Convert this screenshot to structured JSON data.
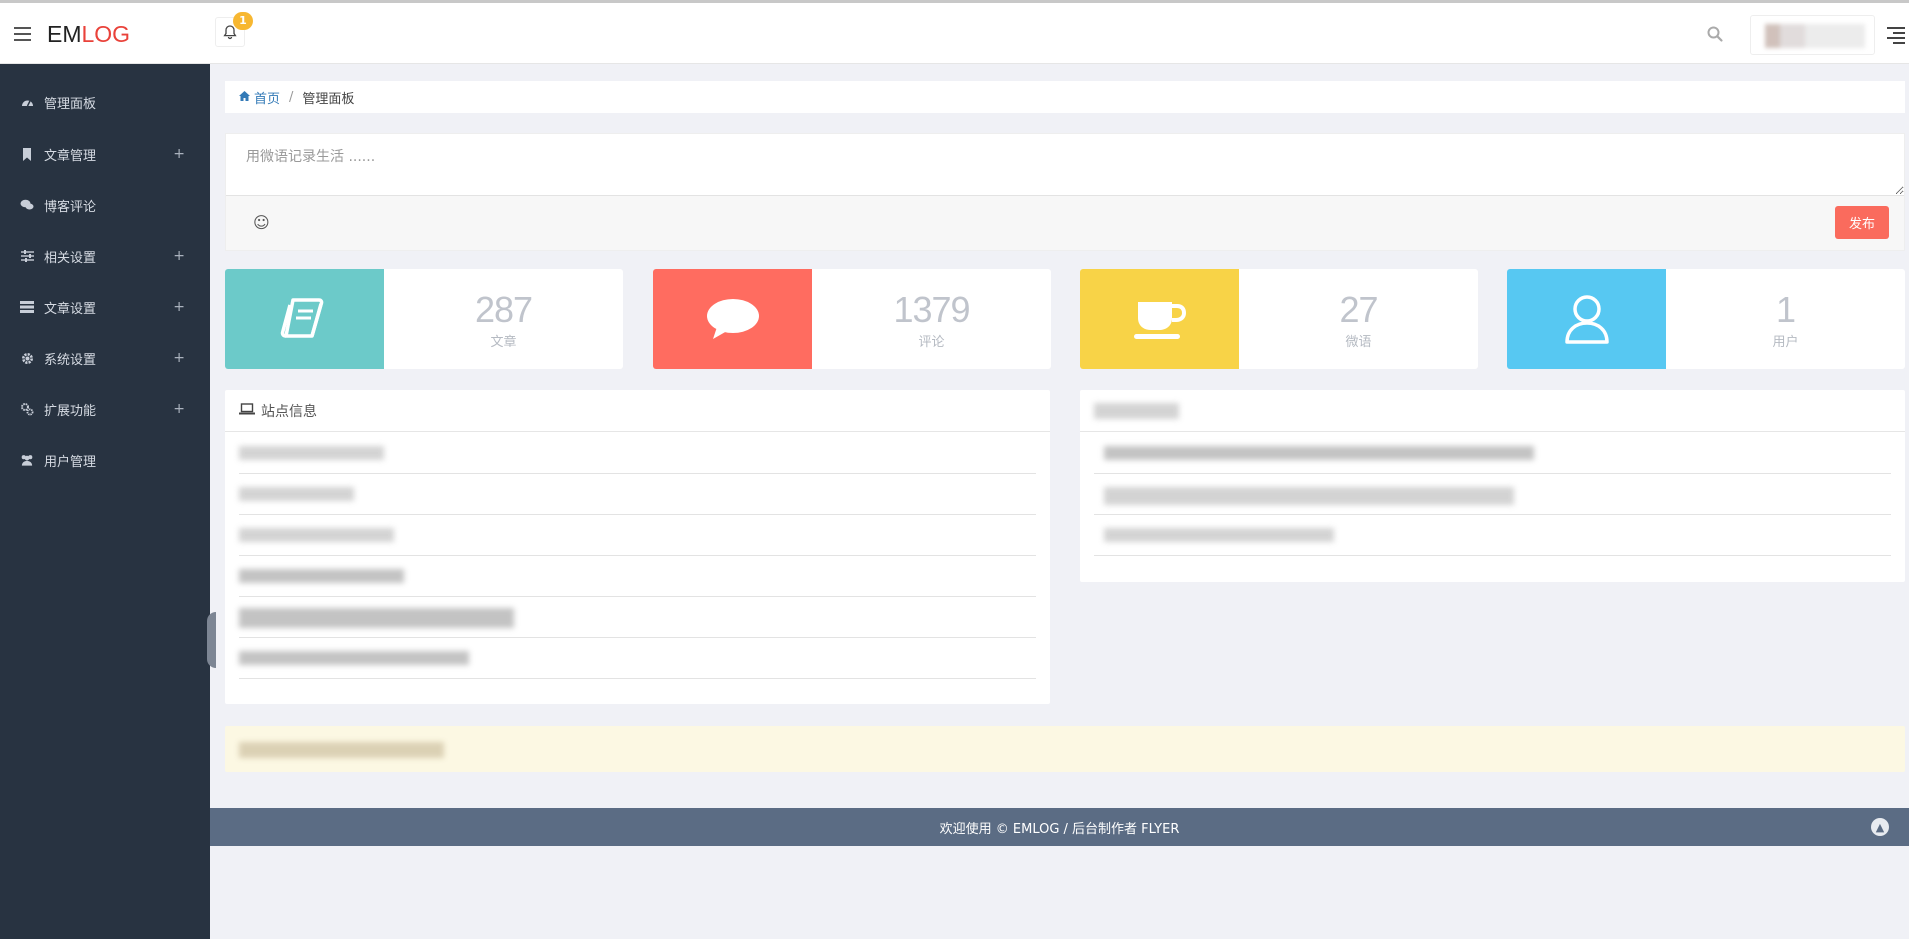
{
  "brand": {
    "part1": "EM",
    "part2": "LOG"
  },
  "notifications": {
    "count": "1"
  },
  "sidebar": {
    "items": [
      {
        "label": "管理面板",
        "icon": "dashboard-icon",
        "expandable": false
      },
      {
        "label": "文章管理",
        "icon": "bookmark-icon",
        "expandable": true
      },
      {
        "label": "博客评论",
        "icon": "comments-icon",
        "expandable": false
      },
      {
        "label": "相关设置",
        "icon": "sliders-icon",
        "expandable": true
      },
      {
        "label": "文章设置",
        "icon": "list-icon",
        "expandable": true
      },
      {
        "label": "系统设置",
        "icon": "gear-icon",
        "expandable": true
      },
      {
        "label": "扩展功能",
        "icon": "puzzle-icon",
        "expandable": true
      },
      {
        "label": "用户管理",
        "icon": "users-icon",
        "expandable": false
      }
    ],
    "plus": "+"
  },
  "breadcrumb": {
    "home": "首页",
    "separator": "/",
    "current": "管理面板"
  },
  "composer": {
    "placeholder": "用微语记录生活 ......",
    "emoji": "☺",
    "publish_label": "发布"
  },
  "stats": [
    {
      "value": "287",
      "label": "文章",
      "color": "#6ccac9",
      "icon": "book-icon"
    },
    {
      "value": "1379",
      "label": "评论",
      "color": "#ff6c60",
      "icon": "comment-icon"
    },
    {
      "value": "27",
      "label": "微语",
      "color": "#f8d347",
      "icon": "coffee-icon"
    },
    {
      "value": "1",
      "label": "用户",
      "color": "#57c8f2",
      "icon": "user-icon"
    }
  ],
  "site_info": {
    "title": "站点信息"
  },
  "footer": {
    "text": "欢迎使用 © EMLOG / 后台制作者 FLYER"
  }
}
